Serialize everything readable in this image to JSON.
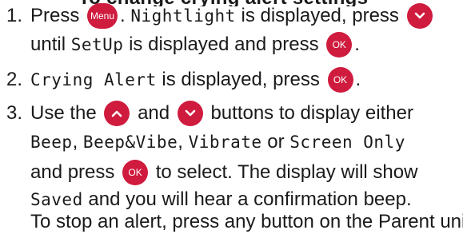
{
  "partial_heading": "To change crying alert settings",
  "buttons": {
    "menu": "Menu",
    "ok": "OK",
    "up_icon": "chevron-up-icon",
    "down_icon": "chevron-down-icon",
    "color": "#cf1b3d"
  },
  "steps": {
    "s1": {
      "num": "1.",
      "t1": "Press",
      "t2": ".",
      "lcd1": "Nightlight",
      "t3": "is displayed, press",
      "t4": "until",
      "lcd2": "SetUp",
      "t5": "is displayed and press",
      "t6": "."
    },
    "s2": {
      "num": "2.",
      "lcd1": "Crying Alert",
      "t1": "is displayed, press",
      "t2": "."
    },
    "s3": {
      "num": "3.",
      "t1": "Use the",
      "t2": "and",
      "t3": "buttons to display either",
      "lcd1": "Beep",
      "sep1": ",",
      "lcd2": "Beep&Vibe",
      "sep2": ",",
      "lcd3": "Vibrate",
      "t4": "or",
      "lcd4": "Screen Only",
      "t5": "and press",
      "t6": "to select. The display will show",
      "lcd5": "Saved",
      "t7": "and you will hear a confirmation beep."
    }
  },
  "note": "To stop an alert, press any button on the Parent unit."
}
